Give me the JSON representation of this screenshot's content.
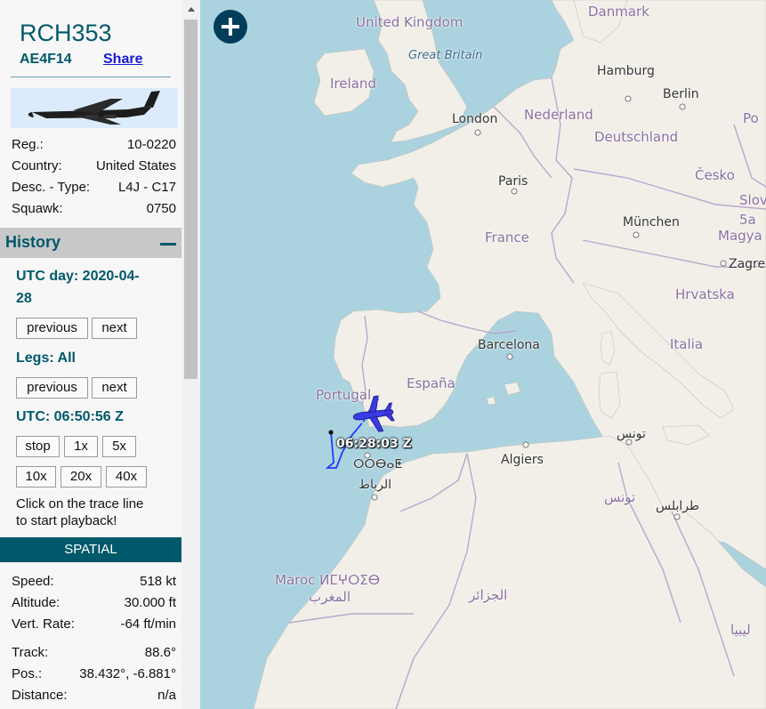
{
  "aircraft": {
    "callsign": "RCH353",
    "hex": "AE4F14",
    "share_label": "Share",
    "details": [
      {
        "label": "Reg.:",
        "value": "10-0220"
      },
      {
        "label": "Country:",
        "value": "United States"
      },
      {
        "label": "Desc. - Type:",
        "value": "L4J - C17"
      },
      {
        "label": "Squawk:",
        "value": "0750"
      }
    ]
  },
  "history": {
    "title": "History",
    "utc_day_line1": "UTC day: 2020-04-",
    "utc_day_line2": "28",
    "day_prev": "previous",
    "day_next": "next",
    "legs": "Legs: All",
    "legs_prev": "previous",
    "legs_next": "next",
    "utc_time": "UTC: 06:50:56 Z",
    "playback": [
      "stop",
      "1x",
      "5x",
      "10x",
      "20x",
      "40x"
    ],
    "hint_line1": "Click on the trace line",
    "hint_line2": "to start playback!"
  },
  "spatial": {
    "title": "SPATIAL",
    "rows_a": [
      {
        "label": "Speed:",
        "value": "518 kt"
      },
      {
        "label": "Altitude:",
        "value": "30.000 ft"
      },
      {
        "label": "Vert. Rate:",
        "value": "-64 ft/min"
      }
    ],
    "rows_b": [
      {
        "label": "Track:",
        "value": "88.6°"
      },
      {
        "label": "Pos.:",
        "value": "38.432°, -6.881°"
      },
      {
        "label": "Distance:",
        "value": "n/a"
      }
    ]
  },
  "map": {
    "aircraft_time_label": "06:28:03 Z",
    "labels": {
      "danmark": "Danmark",
      "united_kingdom": "United Kingdom",
      "great_britain": "Great Britain",
      "ireland": "Ireland",
      "hamburg": "Hamburg",
      "berlin": "Berlin",
      "london": "London",
      "nederland": "Nederland",
      "deutschland": "Deutschland",
      "paris": "Paris",
      "cesko": "Česko",
      "slov": "Slov",
      "munchen": "München",
      "france": "France",
      "magya": "Magya",
      "zagre": "Zagre",
      "hrvatska": "Hrvatska",
      "barcelona": "Barcelona",
      "italia": "Italia",
      "portugal": "Portugal",
      "espana": "España",
      "tunis_ar": "تونس",
      "algiers": "Algiers",
      "tunisia_ar": "تونس",
      "tripoli_ar": "طرابلس",
      "morocco_tif": "ⵍⵎⵖⵔⵉⴱ",
      "rabat_tif": "ⵔⵔⴱⴰⵟ",
      "rabat_ar": "الرباط",
      "maroc": "Maroc ⵍⵎⵖⵔⵉⴱ",
      "maghrib_ar": "المغرب",
      "algeria_ar": "الجزائر",
      "libya_ar": "ليبيا",
      "po": "Po",
      "sa": "5a"
    },
    "colors": {
      "water": "#aad3df",
      "land": "#f2efe9",
      "border": "#b9a7cb",
      "trace": "#1f3bff",
      "plane": "#3a3ae6"
    }
  }
}
